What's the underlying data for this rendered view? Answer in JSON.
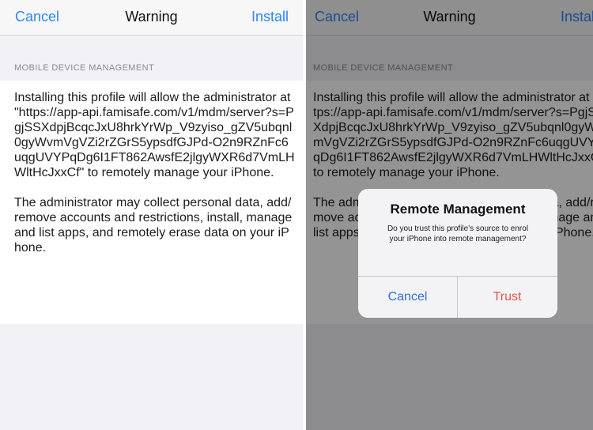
{
  "left_screen": {
    "nav": {
      "cancel": "Cancel",
      "title": "Warning",
      "install": "Install"
    },
    "section_header": "MOBILE DEVICE MANAGEMENT",
    "paragraphs": [
      "Installing this profile will allow the administrator at \"https://app-api.famisafe.com/v1/mdm/server?s=PgjSSXdpjBcqcJxU8hrkYrWp_V9zyiso_gZV5ubqnl0gyWvmVgVZi2rZGrS5ypsdfGJPd-O2n9RZnFc6uqgUVYPqDg6I1FT862AwsfE2jlgyWXR6d7VmLHWltHcJxxCf\" to remotely manage your iPhone.",
      "The administrator may collect personal data, add/remove accounts and restrictions, install, manage and list apps, and remotely erase data on your iPhone."
    ]
  },
  "right_screen": {
    "nav": {
      "cancel": "Cancel",
      "title": "Warning",
      "install": "Install"
    },
    "section_header": "MOBILE DEVICE MANAGEMENT",
    "alert": {
      "title": "Remote Management",
      "message": "Do you trust this profile's source to enrol your iPhone into remote management?",
      "cancel": "Cancel",
      "trust": "Trust"
    }
  },
  "colors": {
    "accent": "#2f86f6",
    "destructive": "#e8554a",
    "grouped_background": "#f2f2f6",
    "section_header": "#8a8a8f"
  }
}
